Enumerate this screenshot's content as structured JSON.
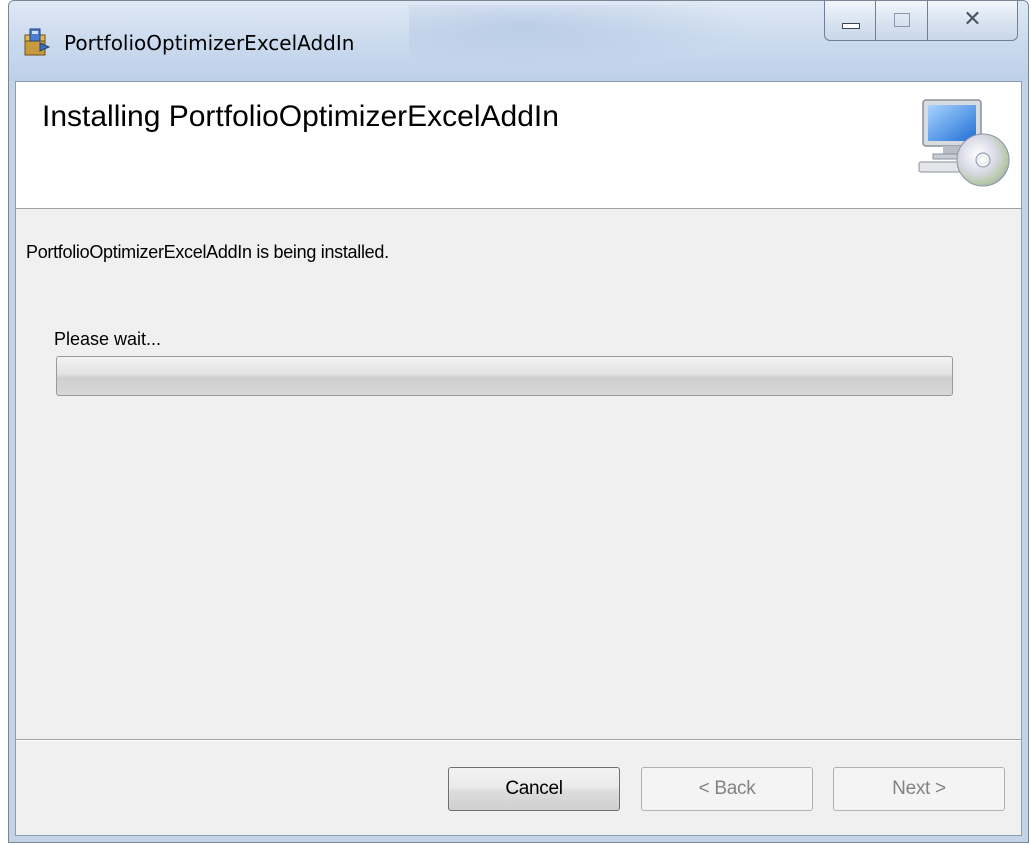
{
  "window": {
    "title": "PortfolioOptimizerExcelAddIn"
  },
  "banner": {
    "title": "Installing PortfolioOptimizerExcelAddIn",
    "icon": "computer-cd-icon"
  },
  "body": {
    "status_text": "PortfolioOptimizerExcelAddIn is being installed.",
    "wait_text": "Please wait...",
    "progress": 0
  },
  "buttons": {
    "cancel": "Cancel",
    "back": "< Back",
    "next": "Next >"
  },
  "colors": {
    "titlebar": "#cbdaee",
    "client_bg": "#f0f0f0",
    "banner_bg": "#ffffff",
    "progress_fill": "#37c83a",
    "disabled_text": "#838383"
  }
}
